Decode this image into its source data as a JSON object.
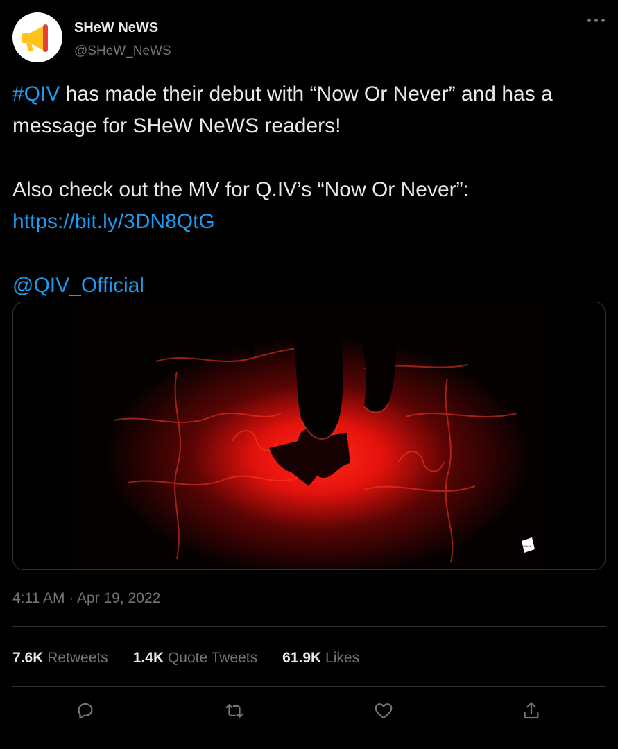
{
  "account": {
    "display_name": "SHeW NeWS",
    "handle": "@SHeW_NeWS",
    "avatar_icon": "megaphone-icon"
  },
  "tweet": {
    "paragraphs": [
      [
        {
          "text": "#QIV",
          "link": true
        },
        {
          "text": " has made their debut with “Now Or Never” and has a message for SHeW NeWS readers!",
          "link": false
        }
      ],
      [],
      [
        {
          "text": "Also check out the MV for Q.IV’s “Now Or Never”:",
          "link": false
        }
      ],
      [
        {
          "text": "https://bit.ly/3DN8QtG",
          "link": true
        }
      ],
      [],
      [
        {
          "text": "@QIV_Official",
          "link": true
        }
      ]
    ],
    "media_watermark": "SHeW",
    "timestamp": "4:11 AM · Apr 19, 2022"
  },
  "stats": {
    "retweets": {
      "count": "7.6K",
      "label": "Retweets"
    },
    "quotes": {
      "count": "1.4K",
      "label": "Quote Tweets"
    },
    "likes": {
      "count": "61.9K",
      "label": "Likes"
    }
  },
  "actions": [
    "reply-icon",
    "retweet-icon",
    "like-icon",
    "share-icon"
  ],
  "colors": {
    "background": "#000000",
    "text": "#e7e9ea",
    "muted": "#71767b",
    "link": "#1d9bf0",
    "border": "#2f3336",
    "media_glow": "#ff1a1a"
  }
}
